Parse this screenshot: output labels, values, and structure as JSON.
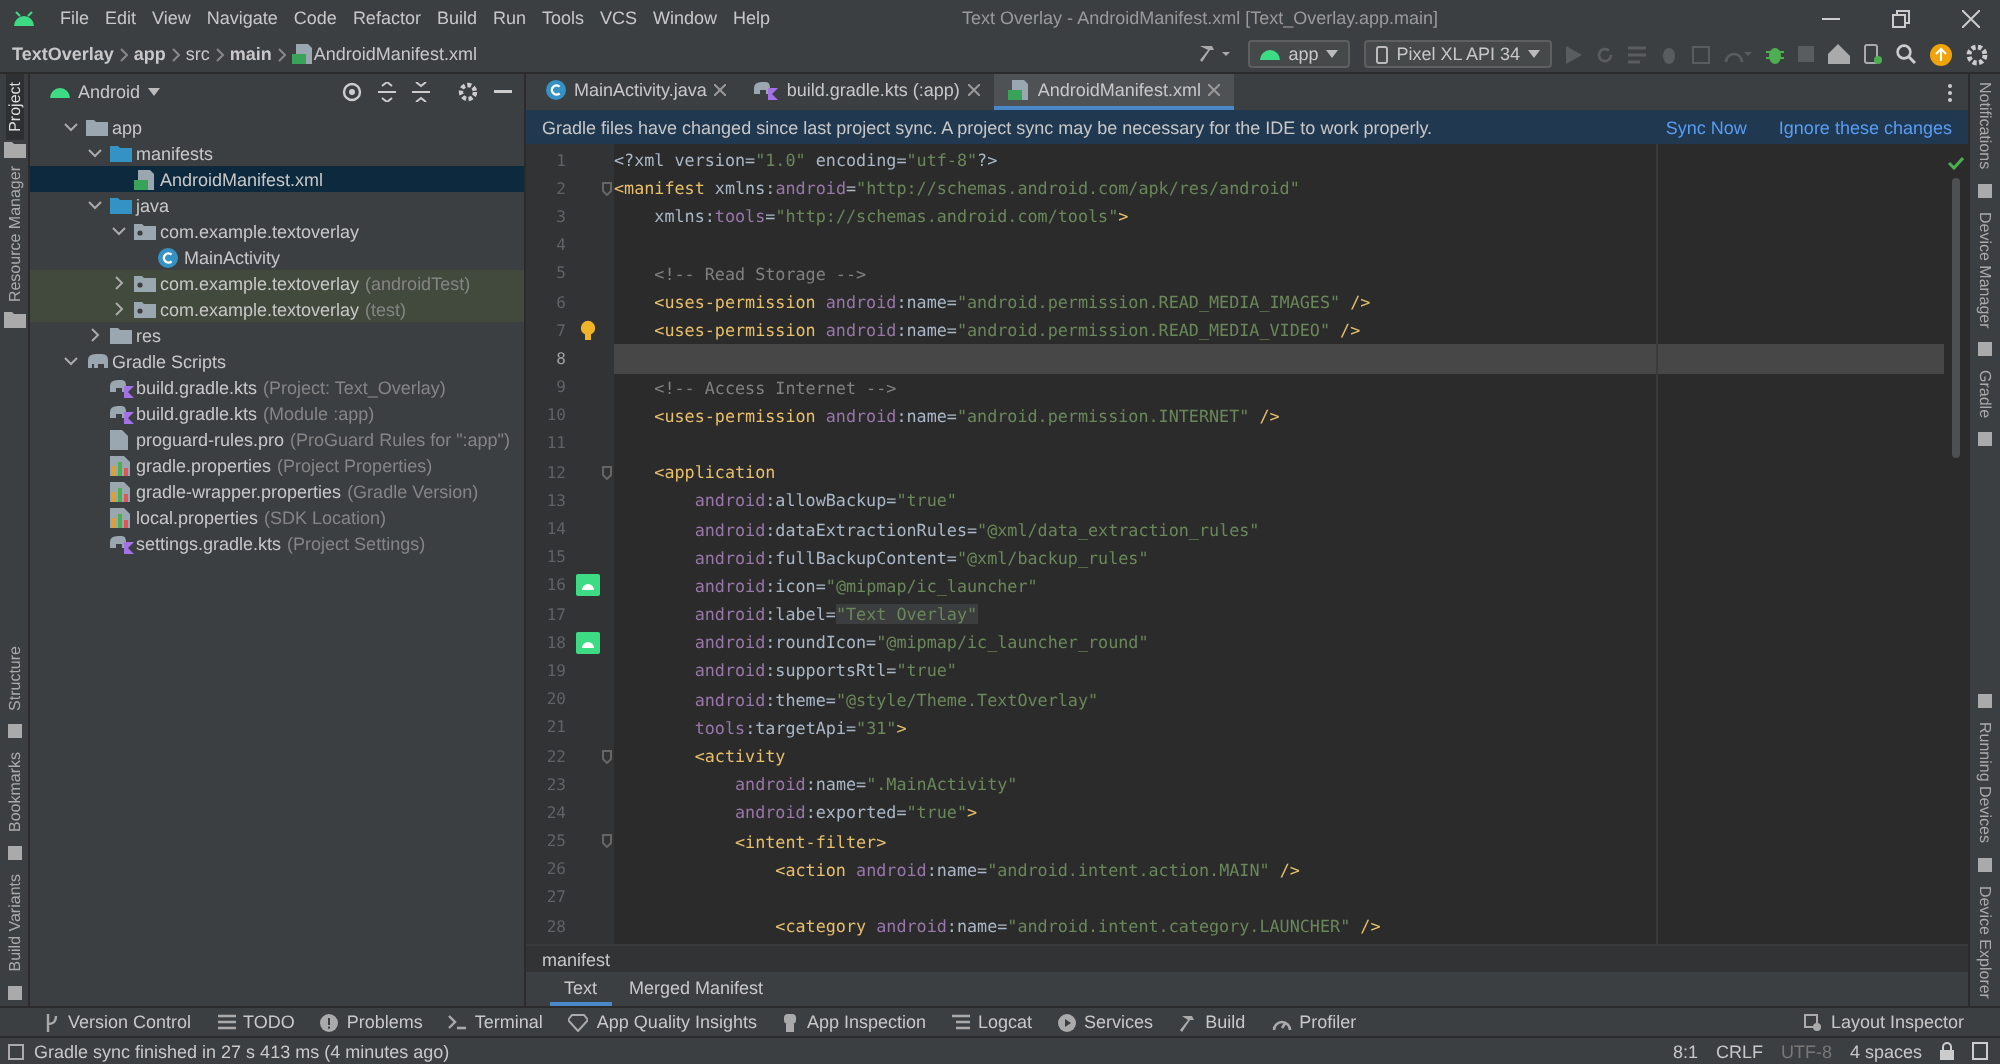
{
  "menu_bar": {
    "items": [
      "File",
      "Edit",
      "View",
      "Navigate",
      "Code",
      "Refactor",
      "Build",
      "Run",
      "Tools",
      "VCS",
      "Window",
      "Help"
    ],
    "title": "Text Overlay - AndroidManifest.xml [Text_Overlay.app.main]"
  },
  "nav_bar": {
    "breadcrumbs": [
      "TextOverlay",
      "app",
      "src",
      "main",
      "AndroidManifest.xml"
    ],
    "run_config": "app",
    "device": "Pixel XL API 34"
  },
  "left_strip": {
    "top": [
      {
        "label": "Project",
        "selected": true
      },
      {
        "label": "Resource Manager",
        "selected": false
      }
    ],
    "bottom": [
      {
        "label": "Structure",
        "selected": false
      },
      {
        "label": "Bookmarks",
        "selected": false
      },
      {
        "label": "Build Variants",
        "selected": false
      }
    ]
  },
  "project_panel": {
    "view": "Android",
    "tree": [
      {
        "label": "app",
        "kind": "module",
        "expanded": true,
        "selected": false,
        "children": [
          {
            "label": "manifests",
            "kind": "folder",
            "expanded": true,
            "selected": false,
            "children": [
              {
                "label": "AndroidManifest.xml",
                "kind": "manifest",
                "selected": true
              }
            ]
          },
          {
            "label": "java",
            "kind": "folder",
            "expanded": true,
            "selected": false,
            "children": [
              {
                "label": "com.example.textoverlay",
                "kind": "package",
                "expanded": true,
                "selected": false,
                "children": [
                  {
                    "label": "MainActivity",
                    "kind": "class",
                    "selected": false
                  }
                ]
              },
              {
                "label": "com.example.textoverlay",
                "hint": "(androidTest)",
                "kind": "test-package",
                "expanded": false,
                "selected": false
              },
              {
                "label": "com.example.textoverlay",
                "hint": "(test)",
                "kind": "test-package",
                "expanded": false,
                "selected": false
              }
            ]
          },
          {
            "label": "res",
            "kind": "res",
            "expanded": false,
            "selected": false
          }
        ]
      },
      {
        "label": "Gradle Scripts",
        "kind": "gradle",
        "expanded": true,
        "selected": false,
        "children": [
          {
            "label": "build.gradle.kts",
            "hint": "(Project: Text_Overlay)",
            "kind": "gradle-kts",
            "selected": false
          },
          {
            "label": "build.gradle.kts",
            "hint": "(Module :app)",
            "kind": "gradle-kts",
            "selected": false
          },
          {
            "label": "proguard-rules.pro",
            "hint": "(ProGuard Rules for \":app\")",
            "kind": "file",
            "selected": false
          },
          {
            "label": "gradle.properties",
            "hint": "(Project Properties)",
            "kind": "properties",
            "selected": false
          },
          {
            "label": "gradle-wrapper.properties",
            "hint": "(Gradle Version)",
            "kind": "properties",
            "selected": false
          },
          {
            "label": "local.properties",
            "hint": "(SDK Location)",
            "kind": "properties",
            "selected": false
          },
          {
            "label": "settings.gradle.kts",
            "hint": "(Project Settings)",
            "kind": "gradle-kts",
            "selected": false
          }
        ]
      }
    ]
  },
  "editor": {
    "tabs": [
      {
        "label": "MainActivity.java",
        "kind": "java",
        "selected": false
      },
      {
        "label": "build.gradle.kts (:app)",
        "kind": "gradle-kts",
        "selected": false
      },
      {
        "label": "AndroidManifest.xml",
        "kind": "manifest",
        "selected": true
      }
    ],
    "banner": {
      "message": "Gradle files have changed since last project sync. A project sync may be necessary for the IDE to work properly.",
      "actions": [
        "Sync Now",
        "Ignore these changes"
      ]
    },
    "lines": [
      {
        "number": "1",
        "kind": "code",
        "current": false,
        "tokens": [
          {
            "kind": "plain",
            "text": "<?xml version="
          },
          {
            "kind": "value",
            "text": "\"1.0\""
          },
          {
            "kind": "plain",
            "text": " encoding="
          },
          {
            "kind": "value",
            "text": "\"utf-8\""
          },
          {
            "kind": "plain",
            "text": "?>"
          }
        ]
      },
      {
        "number": "2",
        "kind": "code",
        "current": false,
        "fold": true,
        "tokens": [
          {
            "kind": "tag",
            "text": "<manifest"
          },
          {
            "kind": "plain",
            "text": " xmlns:"
          },
          {
            "kind": "ns",
            "text": "android"
          },
          {
            "kind": "plain",
            "text": "="
          },
          {
            "kind": "value",
            "text": "\"http://schemas.android.com/apk/res/android\""
          }
        ]
      },
      {
        "number": "3",
        "kind": "code",
        "current": false,
        "tokens": [
          {
            "kind": "plain",
            "text": "    xmlns:"
          },
          {
            "kind": "ns",
            "text": "tools"
          },
          {
            "kind": "plain",
            "text": "="
          },
          {
            "kind": "value",
            "text": "\"http://schemas.android.com/tools\""
          },
          {
            "kind": "tag",
            "text": ">"
          }
        ]
      },
      {
        "number": "4",
        "kind": "code",
        "current": false
      },
      {
        "number": "5",
        "kind": "code",
        "current": false,
        "tokens": [
          {
            "kind": "comment",
            "text": "    <!-- Read Storage -->"
          }
        ]
      },
      {
        "number": "6",
        "kind": "code",
        "current": false,
        "tokens": [
          {
            "kind": "tag",
            "text": "    <uses-permission"
          },
          {
            "kind": "ns",
            "text": " android"
          },
          {
            "kind": "plain",
            "text": ":name="
          },
          {
            "kind": "value",
            "text": "\"android.permission.READ_MEDIA_IMAGES\""
          },
          {
            "kind": "tag",
            "text": " />"
          }
        ]
      },
      {
        "number": "7",
        "kind": "intention",
        "current": false,
        "tokens": [
          {
            "kind": "tag",
            "text": "    <uses-permission"
          },
          {
            "kind": "ns",
            "text": " android"
          },
          {
            "kind": "plain",
            "text": ":name="
          },
          {
            "kind": "value",
            "text": "\"android.permission.READ_MEDIA_VIDEO\""
          },
          {
            "kind": "tag",
            "text": " />"
          }
        ]
      },
      {
        "number": "8",
        "kind": "code",
        "current": true
      },
      {
        "number": "9",
        "kind": "code",
        "current": false,
        "tokens": [
          {
            "kind": "comment",
            "text": "    <!-- Access Internet -->"
          }
        ]
      },
      {
        "number": "10",
        "kind": "code",
        "current": false,
        "tokens": [
          {
            "kind": "tag",
            "text": "    <uses-permission"
          },
          {
            "kind": "ns",
            "text": " android"
          },
          {
            "kind": "plain",
            "text": ":name="
          },
          {
            "kind": "value",
            "text": "\"android.permission.INTERNET\""
          },
          {
            "kind": "tag",
            "text": " />"
          }
        ]
      },
      {
        "number": "11",
        "kind": "code",
        "current": false
      },
      {
        "number": "12",
        "kind": "code",
        "current": false,
        "fold": true,
        "tokens": [
          {
            "kind": "tag",
            "text": "    <application"
          }
        ]
      },
      {
        "number": "13",
        "kind": "code",
        "current": false,
        "tokens": [
          {
            "kind": "ns",
            "text": "        android"
          },
          {
            "kind": "plain",
            "text": ":allowBackup="
          },
          {
            "kind": "value",
            "text": "\"true\""
          }
        ]
      },
      {
        "number": "14",
        "kind": "code",
        "current": false,
        "tokens": [
          {
            "kind": "ns",
            "text": "        android"
          },
          {
            "kind": "plain",
            "text": ":dataExtractionRules="
          },
          {
            "kind": "value",
            "text": "\"@xml/data_extraction_rules\""
          }
        ]
      },
      {
        "number": "15",
        "kind": "code",
        "current": false,
        "tokens": [
          {
            "kind": "ns",
            "text": "        android"
          },
          {
            "kind": "plain",
            "text": ":fullBackupContent="
          },
          {
            "kind": "value",
            "text": "\"@xml/backup_rules\""
          }
        ]
      },
      {
        "number": "16",
        "kind": "resource",
        "current": false,
        "tokens": [
          {
            "kind": "ns",
            "text": "        android"
          },
          {
            "kind": "plain",
            "text": ":icon="
          },
          {
            "kind": "value",
            "text": "\"@mipmap/ic_launcher\""
          }
        ]
      },
      {
        "number": "17",
        "kind": "code",
        "current": false,
        "tokens": [
          {
            "kind": "ns",
            "text": "        android"
          },
          {
            "kind": "plain",
            "text": ":label="
          },
          {
            "kind": "folded",
            "text": "\"Text Overlay\""
          }
        ]
      },
      {
        "number": "18",
        "kind": "resource",
        "current": false,
        "tokens": [
          {
            "kind": "ns",
            "text": "        android"
          },
          {
            "kind": "plain",
            "text": ":roundIcon="
          },
          {
            "kind": "value",
            "text": "\"@mipmap/ic_launcher_round\""
          }
        ]
      },
      {
        "number": "19",
        "kind": "code",
        "current": false,
        "tokens": [
          {
            "kind": "ns",
            "text": "        android"
          },
          {
            "kind": "plain",
            "text": ":supportsRtl="
          },
          {
            "kind": "value",
            "text": "\"true\""
          }
        ]
      },
      {
        "number": "20",
        "kind": "code",
        "current": false,
        "tokens": [
          {
            "kind": "ns",
            "text": "        android"
          },
          {
            "kind": "plain",
            "text": ":theme="
          },
          {
            "kind": "value",
            "text": "\"@style/Theme.TextOverlay\""
          }
        ]
      },
      {
        "number": "21",
        "kind": "code",
        "current": false,
        "tokens": [
          {
            "kind": "ns",
            "text": "        tools"
          },
          {
            "kind": "plain",
            "text": ":targetApi="
          },
          {
            "kind": "value",
            "text": "\"31\""
          },
          {
            "kind": "tag",
            "text": ">"
          }
        ]
      },
      {
        "number": "22",
        "kind": "code",
        "current": false,
        "fold": true,
        "tokens": [
          {
            "kind": "tag",
            "text": "        <activity"
          }
        ]
      },
      {
        "number": "23",
        "kind": "code",
        "current": false,
        "tokens": [
          {
            "kind": "ns",
            "text": "            android"
          },
          {
            "kind": "plain",
            "text": ":name="
          },
          {
            "kind": "value",
            "text": "\".MainActivity\""
          }
        ]
      },
      {
        "number": "24",
        "kind": "code",
        "current": false,
        "tokens": [
          {
            "kind": "ns",
            "text": "            android"
          },
          {
            "kind": "plain",
            "text": ":exported="
          },
          {
            "kind": "value",
            "text": "\"true\""
          },
          {
            "kind": "tag",
            "text": ">"
          }
        ]
      },
      {
        "number": "25",
        "kind": "code",
        "current": false,
        "fold": true,
        "tokens": [
          {
            "kind": "tag",
            "text": "            <intent-filter>"
          }
        ]
      },
      {
        "number": "26",
        "kind": "code",
        "current": false,
        "tokens": [
          {
            "kind": "tag",
            "text": "                <action"
          },
          {
            "kind": "ns",
            "text": " android"
          },
          {
            "kind": "plain",
            "text": ":name="
          },
          {
            "kind": "value",
            "text": "\"android.intent.action.MAIN\""
          },
          {
            "kind": "tag",
            "text": " />"
          }
        ]
      },
      {
        "number": "27",
        "kind": "code",
        "current": false
      },
      {
        "number": "28",
        "kind": "code",
        "current": false,
        "tokens": [
          {
            "kind": "tag",
            "text": "                <category"
          },
          {
            "kind": "ns",
            "text": " android"
          },
          {
            "kind": "plain",
            "text": ":name="
          },
          {
            "kind": "value",
            "text": "\"android.intent.category.LAUNCHER\""
          },
          {
            "kind": "tag",
            "text": " />"
          }
        ]
      }
    ],
    "breadcrumb": "manifest",
    "bottom_tabs": [
      {
        "label": "Text",
        "selected": true
      },
      {
        "label": "Merged Manifest",
        "selected": false
      }
    ]
  },
  "right_strip": {
    "top": [
      "Notifications",
      "Device Manager",
      "Gradle"
    ],
    "bottom": [
      "Running Devices",
      "Device Explorer"
    ]
  },
  "tool_bar": {
    "left": [
      "Version Control",
      "TODO",
      "Problems",
      "Terminal",
      "App Quality Insights",
      "App Inspection",
      "Logcat",
      "Services",
      "Build",
      "Profiler"
    ],
    "right": [
      "Layout Inspector"
    ]
  },
  "status_bar": {
    "message": "Gradle sync finished in 27 s 413 ms (4 minutes ago)",
    "items": [
      {
        "label": "8:1",
        "disabled": false
      },
      {
        "label": "CRLF",
        "disabled": false
      },
      {
        "label": "UTF-8",
        "disabled": true
      },
      {
        "label": "4 spaces",
        "disabled": false
      }
    ]
  }
}
